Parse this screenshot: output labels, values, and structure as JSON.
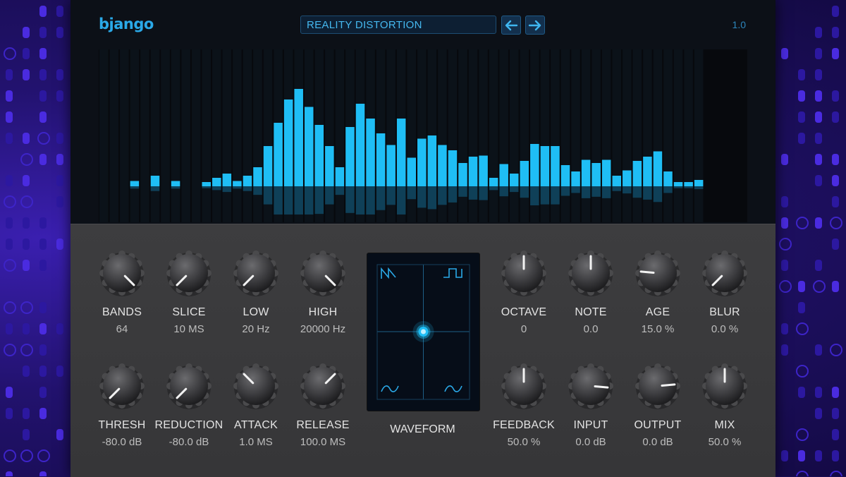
{
  "app": {
    "logo": "bjango",
    "preset": "REALITY DISTORTION",
    "version": "1.0"
  },
  "colors": {
    "accent": "#1fbef5",
    "panel": "#3a3a3c",
    "display_bg": "#07090d",
    "backdrop": "#22126e"
  },
  "spectrum": {
    "levels": [
      0,
      0,
      0,
      0.05,
      0,
      0.1,
      0,
      0.05,
      0,
      0,
      0.04,
      0.08,
      0.12,
      0.05,
      0.1,
      0.18,
      0.38,
      0.6,
      0.82,
      0.92,
      0.75,
      0.58,
      0.38,
      0.18,
      0.56,
      0.78,
      0.64,
      0.5,
      0.39,
      0.64,
      0.27,
      0.45,
      0.48,
      0.39,
      0.34,
      0.22,
      0.28,
      0.29,
      0.08,
      0.21,
      0.12,
      0.24,
      0.4,
      0.38,
      0.38,
      0.2,
      0.14,
      0.25,
      0.22,
      0.25,
      0.1,
      0.15,
      0.24,
      0.28,
      0.33,
      0.14,
      0.04,
      0.04,
      0.06
    ]
  },
  "controls": [
    {
      "id": "bands",
      "label": "BANDS",
      "value": "64",
      "row": 0,
      "col": 0,
      "angle": 135
    },
    {
      "id": "slice",
      "label": "SLICE",
      "value": "10 MS",
      "row": 0,
      "col": 1,
      "angle": -135
    },
    {
      "id": "low",
      "label": "LOW",
      "value": "20 Hz",
      "row": 0,
      "col": 2,
      "angle": -135
    },
    {
      "id": "high",
      "label": "HIGH",
      "value": "20000 Hz",
      "row": 0,
      "col": 3,
      "angle": 135
    },
    {
      "id": "octave",
      "label": "OCTAVE",
      "value": "0",
      "row": 0,
      "col": 4,
      "angle": 0
    },
    {
      "id": "note",
      "label": "NOTE",
      "value": "0.0",
      "row": 0,
      "col": 5,
      "angle": 0
    },
    {
      "id": "age",
      "label": "AGE",
      "value": "15.0 %",
      "row": 0,
      "col": 6,
      "angle": -85
    },
    {
      "id": "blur",
      "label": "BLUR",
      "value": "0.0 %",
      "row": 0,
      "col": 7,
      "angle": -135
    },
    {
      "id": "thresh",
      "label": "THRESH",
      "value": "-80.0 dB",
      "row": 1,
      "col": 0,
      "angle": -135
    },
    {
      "id": "reduction",
      "label": "REDUCTION",
      "value": "-80.0 dB",
      "row": 1,
      "col": 1,
      "angle": -135
    },
    {
      "id": "attack",
      "label": "ATTACK",
      "value": "1.0 MS",
      "row": 1,
      "col": 2,
      "angle": -45
    },
    {
      "id": "release",
      "label": "RELEASE",
      "value": "100.0 MS",
      "row": 1,
      "col": 3,
      "angle": 45
    },
    {
      "id": "feedback",
      "label": "FEEDBACK",
      "value": "50.0 %",
      "row": 1,
      "col": 4,
      "angle": 0
    },
    {
      "id": "input",
      "label": "INPUT",
      "value": "0.0 dB",
      "row": 1,
      "col": 5,
      "angle": 95
    },
    {
      "id": "output",
      "label": "OUTPUT",
      "value": "0.0 dB",
      "row": 1,
      "col": 6,
      "angle": 85
    },
    {
      "id": "mix",
      "label": "MIX",
      "value": "50.0 %",
      "row": 1,
      "col": 7,
      "angle": 0
    }
  ],
  "waveform": {
    "label": "WAVEFORM",
    "corners": [
      "sawtooth-icon",
      "square-icon",
      "sine-icon",
      "sine-icon"
    ]
  }
}
